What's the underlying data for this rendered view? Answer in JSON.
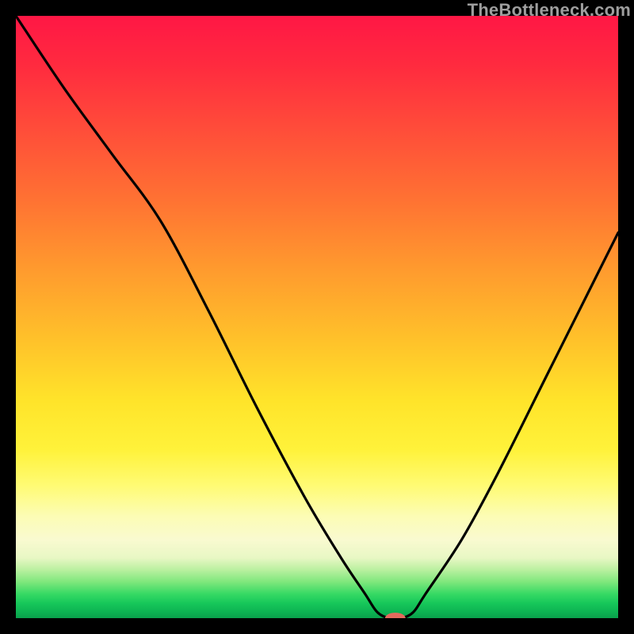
{
  "watermark_text": "TheBottleneck.com",
  "chart_data": {
    "type": "line",
    "title": "",
    "xlabel": "",
    "ylabel": "",
    "xlim": [
      0,
      100
    ],
    "ylim": [
      0,
      100
    ],
    "grid": false,
    "legend": false,
    "series": [
      {
        "name": "bottleneck-curve",
        "x": [
          0,
          8,
          16,
          24,
          32,
          40,
          48,
          54,
          58,
          60,
          62,
          64,
          66,
          68,
          74,
          80,
          88,
          96,
          100
        ],
        "values": [
          100,
          88,
          77,
          66,
          51,
          35,
          20,
          10,
          4,
          1,
          0,
          0,
          1,
          4,
          13,
          24,
          40,
          56,
          64
        ]
      }
    ],
    "marker": {
      "x": 63,
      "y": 0,
      "rx": 1.7,
      "ry": 0.9
    },
    "background_gradient_stops": [
      {
        "pct": 0,
        "color": "#ff1745"
      },
      {
        "pct": 54,
        "color": "#ffc22a"
      },
      {
        "pct": 78,
        "color": "#fffb74"
      },
      {
        "pct": 94,
        "color": "#7ee77c"
      },
      {
        "pct": 100,
        "color": "#0aa04c"
      }
    ]
  }
}
